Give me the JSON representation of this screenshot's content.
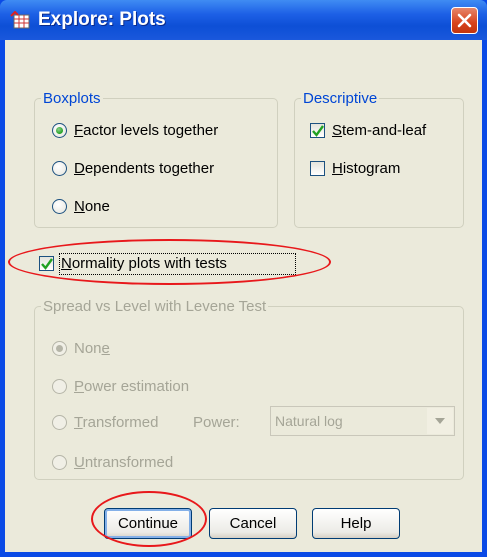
{
  "window": {
    "title": "Explore: Plots",
    "accent": "#0a4ae6",
    "close_icon": "close-icon"
  },
  "boxplots": {
    "legend": "Boxplots",
    "options": [
      {
        "pre": "",
        "key": "F",
        "rest": "actor levels together",
        "selected": true
      },
      {
        "pre": "",
        "key": "D",
        "rest": "ependents together",
        "selected": false
      },
      {
        "pre": "",
        "key": "N",
        "rest": "one",
        "selected": false
      }
    ]
  },
  "descriptive": {
    "legend": "Descriptive",
    "options": [
      {
        "pre": "",
        "key": "S",
        "rest": "tem-and-leaf",
        "checked": true
      },
      {
        "pre": "",
        "key": "H",
        "rest": "istogram",
        "checked": false
      }
    ]
  },
  "normality": {
    "pre": "",
    "key": "N",
    "rest": "ormality plots with tests",
    "checked": true
  },
  "spread": {
    "legend": "Spread vs Level with Levene Test",
    "enabled": false,
    "options": [
      {
        "pre": "Non",
        "key": "e",
        "rest": "",
        "selected": true
      },
      {
        "pre": "",
        "key": "P",
        "rest": "ower estimation",
        "selected": false
      },
      {
        "pre": "",
        "key": "T",
        "rest": "ransformed",
        "selected": false
      },
      {
        "pre": "",
        "key": "U",
        "rest": "ntransformed",
        "selected": false
      }
    ],
    "power_label_pre": "Po",
    "power_label_key": "w",
    "power_label_rest": "er:",
    "power_value": "Natural log"
  },
  "buttons": {
    "continue": "Continue",
    "cancel": "Cancel",
    "help": "Help"
  },
  "highlight_color": "#e8181b"
}
